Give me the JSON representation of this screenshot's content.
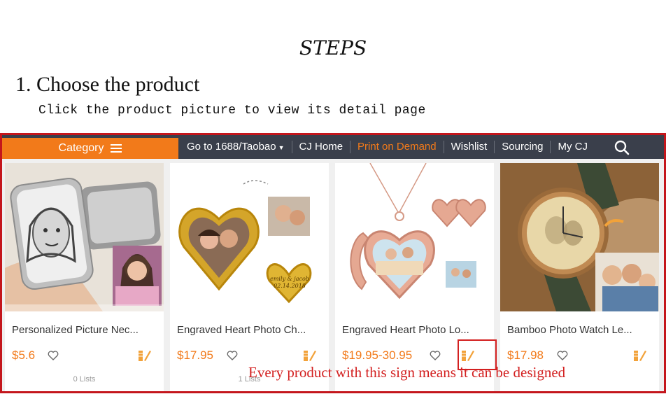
{
  "header": {
    "title": "STEPS",
    "step_heading": "1. Choose the product",
    "step_subtitle": "Click the product picture to view its detail page"
  },
  "topbar": {
    "category_label": "Category",
    "nav": [
      {
        "label": "Go to 1688/Taobao",
        "dropdown": true
      },
      {
        "label": "CJ Home"
      },
      {
        "label": "Print on Demand",
        "active": true
      },
      {
        "label": "Wishlist"
      },
      {
        "label": "Sourcing"
      },
      {
        "label": "My CJ"
      }
    ]
  },
  "products": [
    {
      "name": "Personalized Picture Nec...",
      "price": "$5.6",
      "lists": "0 Lists"
    },
    {
      "name": "Engraved Heart Photo Ch...",
      "price": "$17.95",
      "lists": "1 Lists"
    },
    {
      "name": "Engraved Heart Photo Lo...",
      "price": "$19.95-30.95",
      "lists": ""
    },
    {
      "name": "Bamboo Photo Watch Le...",
      "price": "$17.98",
      "lists": ""
    }
  ],
  "charm_engraving": {
    "line1": "emily & jacob",
    "line2": "02.14.2018"
  },
  "callout": {
    "text": "Every product with this sign means it can be designed"
  },
  "colors": {
    "accent": "#f27a1a",
    "frame": "#c4161c",
    "topbar": "#3a3f4b",
    "callout": "#d32020"
  },
  "icons": {
    "menu": "hamburger-icon",
    "search": "search-icon",
    "favorite": "heart-icon",
    "design": "design-pencil-icon"
  }
}
